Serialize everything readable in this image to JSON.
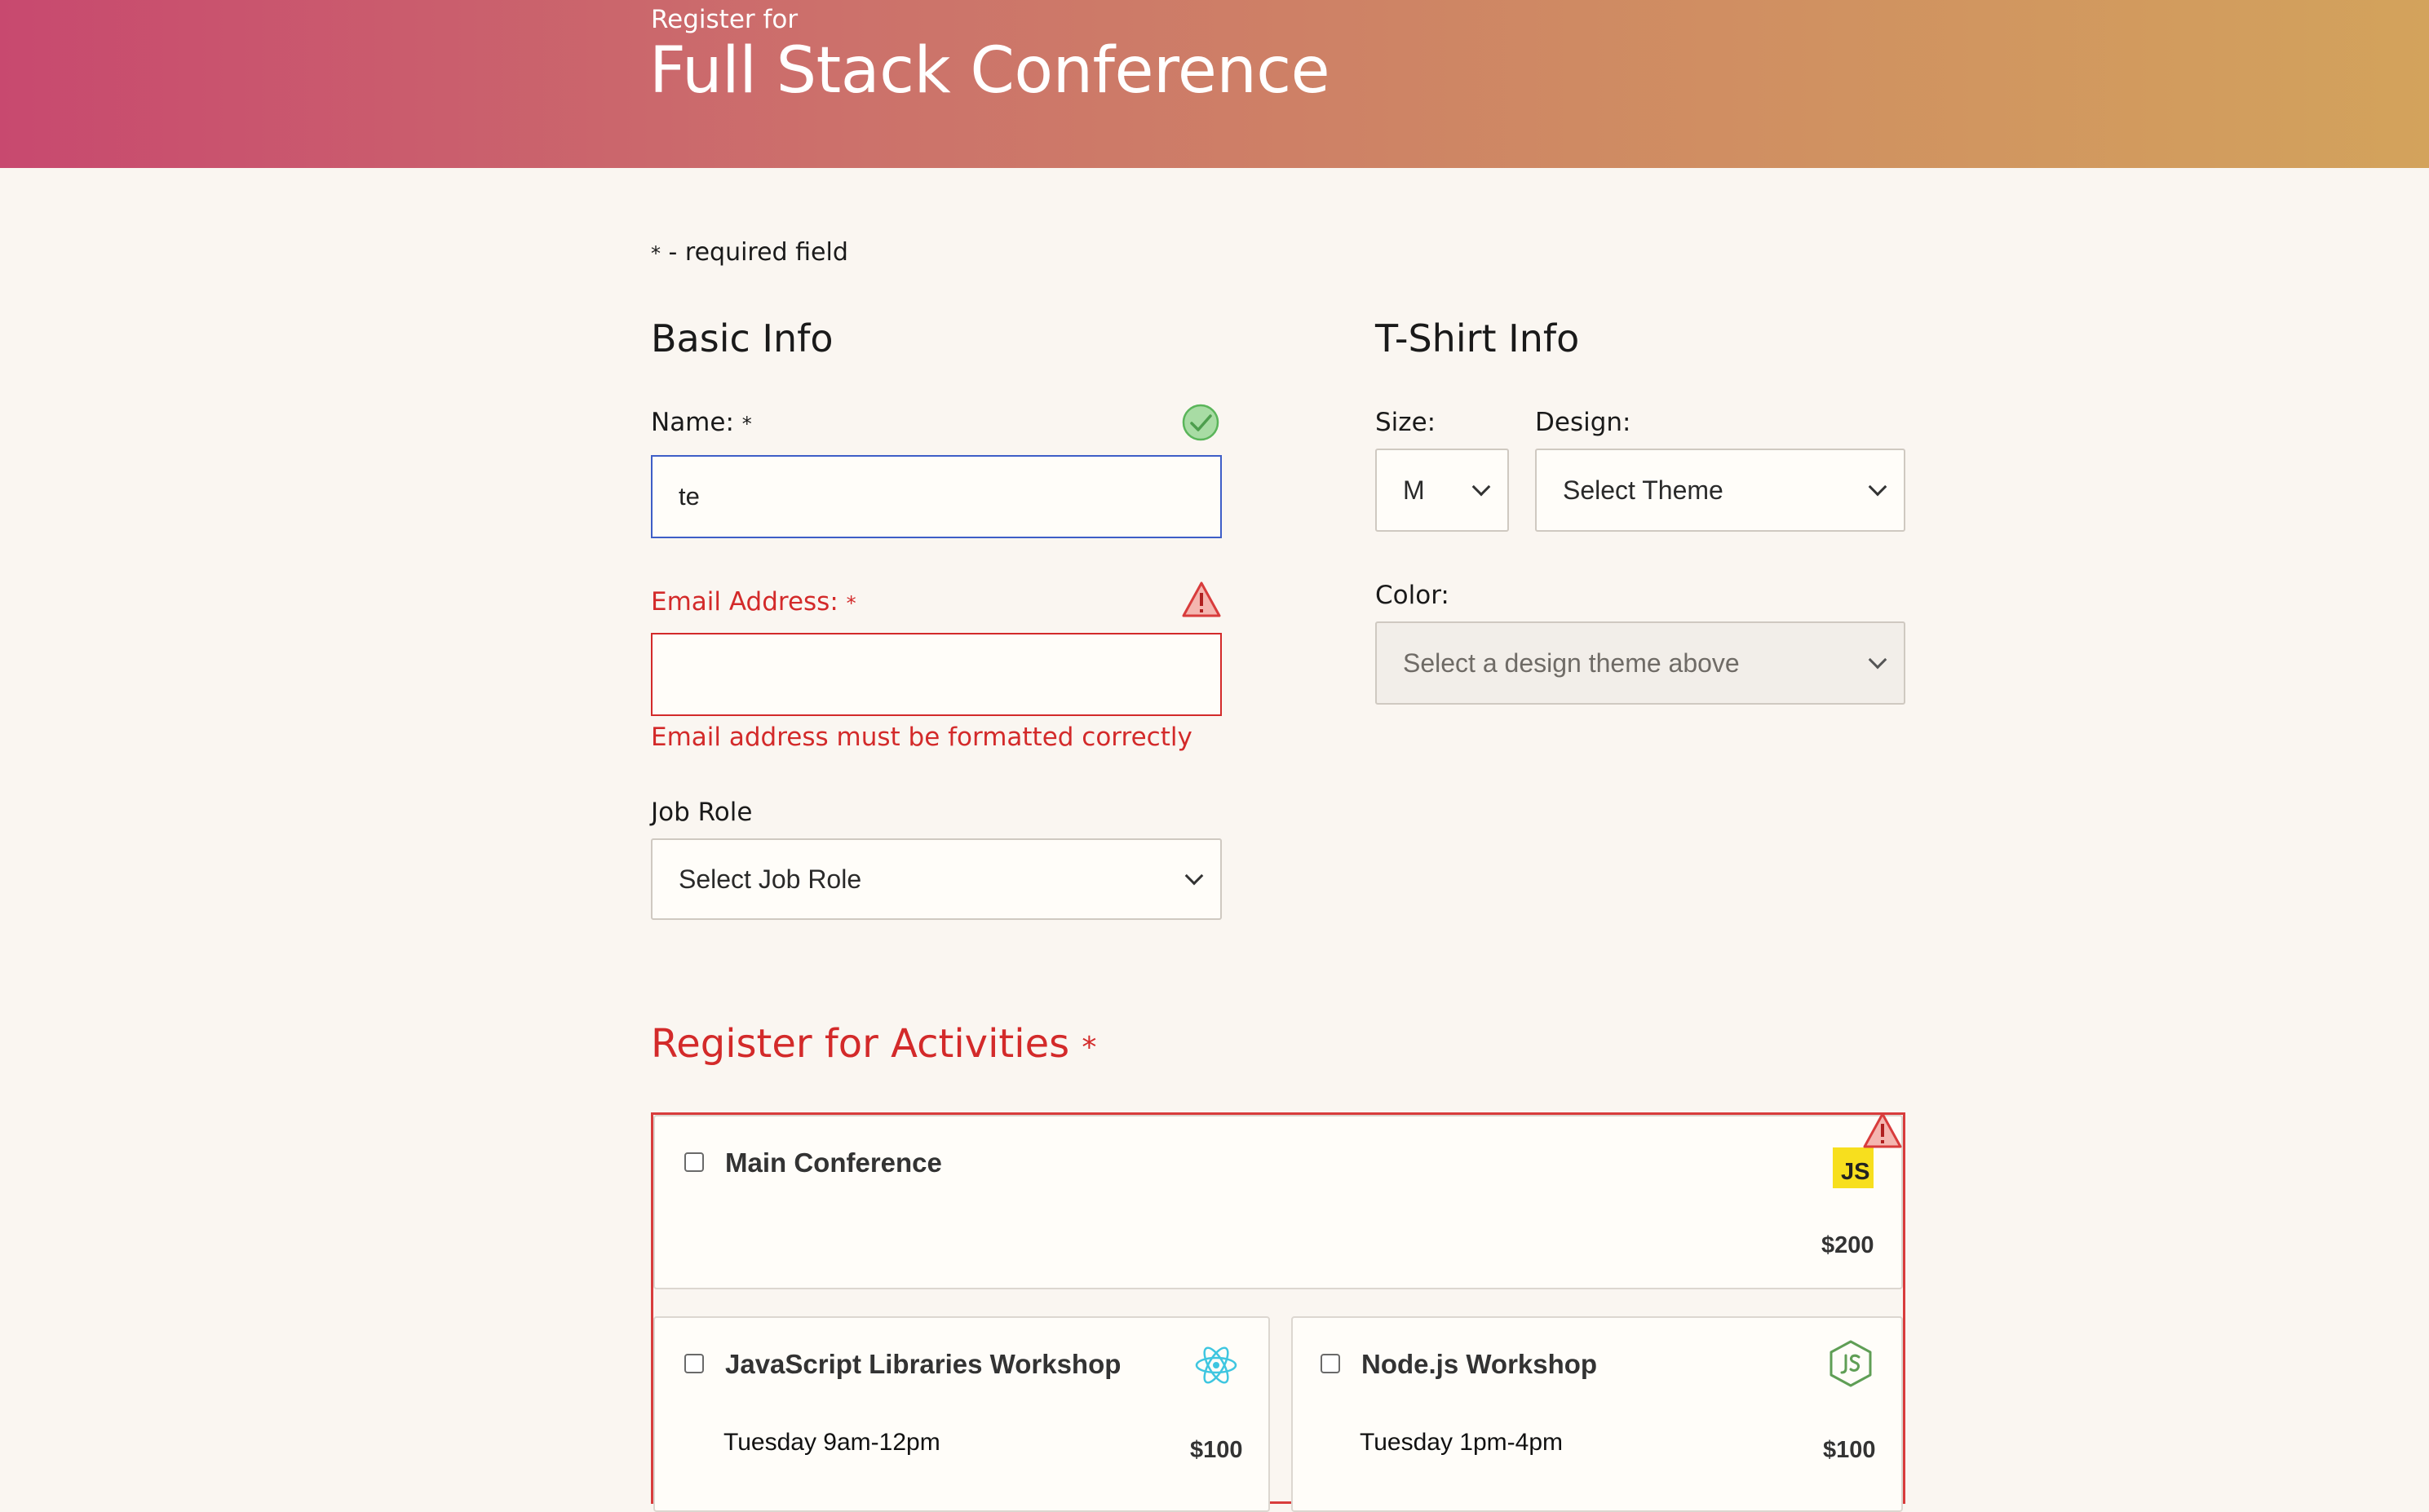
{
  "header": {
    "subtitle": "Register for",
    "title": "Full Stack Conference"
  },
  "required_note": {
    "star": "*",
    "text": " - required field"
  },
  "basic_info": {
    "heading": "Basic Info",
    "name": {
      "label": "Name: ",
      "star": "*",
      "value": "te",
      "status": "valid"
    },
    "email": {
      "label": "Email Address: ",
      "star": "*",
      "value": "",
      "error": "Email address must be formatted correctly",
      "status": "error"
    },
    "job_role": {
      "label": "Job Role",
      "selected": "Select Job Role"
    }
  },
  "tshirt_info": {
    "heading": "T-Shirt Info",
    "size": {
      "label": "Size:",
      "selected": "M"
    },
    "design": {
      "label": "Design:",
      "selected": "Select Theme"
    },
    "color": {
      "label": "Color:",
      "selected": "Select a design theme above"
    }
  },
  "activities": {
    "heading": "Register for Activities ",
    "star": "*",
    "items": [
      {
        "title": "Main Conference",
        "time": "",
        "price": "$200",
        "icon": "javascript-icon",
        "checked": false
      },
      {
        "title": "JavaScript Libraries Workshop",
        "time": "Tuesday 9am-12pm",
        "price": "$100",
        "icon": "react-icon",
        "checked": false
      },
      {
        "title": "Node.js Workshop",
        "time": "Tuesday 1pm-4pm",
        "price": "$100",
        "icon": "nodejs-icon",
        "checked": false
      }
    ],
    "js_badge_text": "JS"
  },
  "colors": {
    "error": "#d32a2a",
    "focus": "#3e5ec7",
    "valid": "#5ab55a",
    "header_start": "#c8496f",
    "header_end": "#d3a35c"
  }
}
